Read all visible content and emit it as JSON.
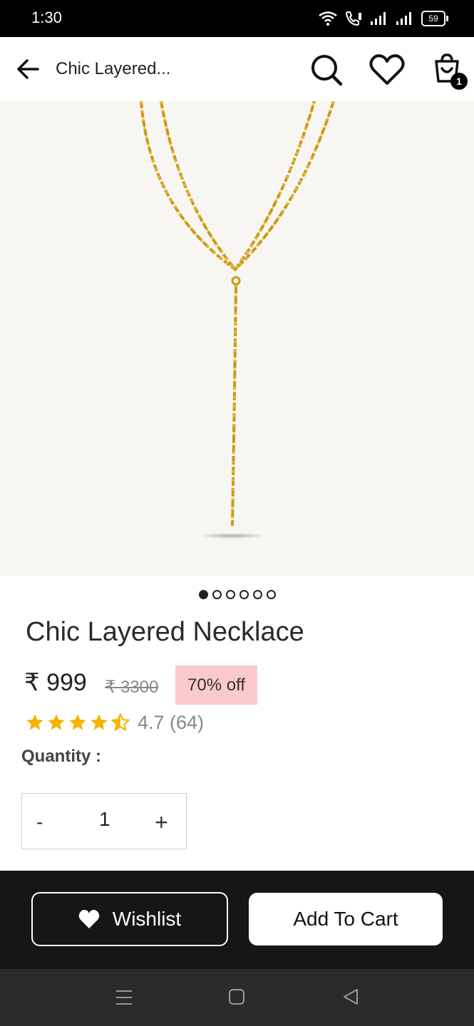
{
  "status_bar": {
    "time": "1:30",
    "battery": "59",
    "icons": [
      "wifi-icon",
      "volte-icon",
      "signal-icon",
      "signal-icon",
      "battery-icon"
    ]
  },
  "header": {
    "title": "Chic Layered...",
    "icons": [
      "back-arrow-icon",
      "search-icon",
      "heart-icon",
      "cart-icon"
    ],
    "cart_count": "1"
  },
  "product": {
    "image": "gold-layered-necklace",
    "carousel": {
      "total": 6,
      "active": 0
    },
    "name": "Chic Layered Necklace",
    "price": "₹ 999",
    "mrp": "₹ 3300",
    "discount": "70% off",
    "rating_value": 4.7,
    "rating_text": "4.7 (64)",
    "star_color": "#f6b400"
  },
  "quantity": {
    "label": "Quantity :",
    "minus": "-",
    "value": "1",
    "plus": "+"
  },
  "actions": {
    "wishlist_label": "Wishlist",
    "add_to_cart_label": "Add To Cart"
  },
  "nav_bar": {
    "icons": [
      "menu-icon",
      "home-icon",
      "back-icon"
    ]
  }
}
